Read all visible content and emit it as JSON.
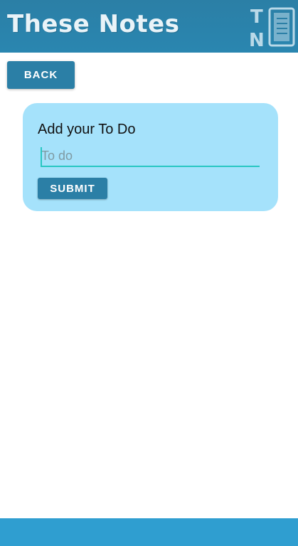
{
  "header": {
    "app_title": "These Notes",
    "logo_icon": "notebook-logo-icon",
    "logo_letters": [
      "T",
      "N"
    ]
  },
  "nav": {
    "back_label": "BACK"
  },
  "todo_form": {
    "title": "Add your To Do",
    "input_value": "",
    "input_placeholder": "To do",
    "submit_label": "SUBMIT"
  },
  "colors": {
    "header": "#2b7fa6",
    "button": "#2b7fa6",
    "card": "#a5e2fb",
    "input_underline": "#27c7c2",
    "footer": "#2f9ed0"
  }
}
